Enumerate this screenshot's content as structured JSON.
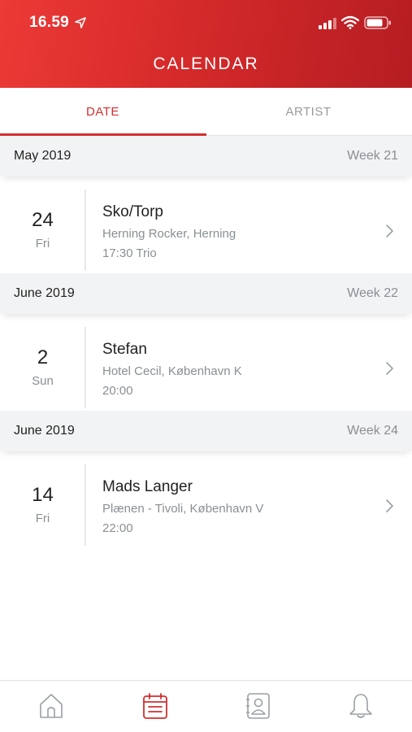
{
  "status_bar": {
    "time": "16.59"
  },
  "header": {
    "title": "CALENDAR"
  },
  "tabs": [
    {
      "label": "DATE",
      "active": true
    },
    {
      "label": "ARTIST",
      "active": false
    }
  ],
  "sections": [
    {
      "month": "May 2019",
      "week": "Week 21",
      "event": {
        "day": "24",
        "weekday": "Fri",
        "name": "Sko/Torp",
        "venue": "Herning Rocker, Herning",
        "time": "17:30  Trio"
      }
    },
    {
      "month": "June 2019",
      "week": "Week 22",
      "event": {
        "day": "2",
        "weekday": "Sun",
        "name": "Stefan",
        "venue": "Hotel Cecil, København K",
        "time": "20:00"
      }
    },
    {
      "month": "June 2019",
      "week": "Week 24",
      "event": {
        "day": "14",
        "weekday": "Fri",
        "name": "Mads Langer",
        "venue": "Plænen - Tivoli, København V",
        "time": "22:00"
      }
    }
  ],
  "tab_bar": {
    "items": [
      {
        "icon": "home-icon",
        "active": false
      },
      {
        "icon": "calendar-icon",
        "active": true
      },
      {
        "icon": "contacts-icon",
        "active": false
      },
      {
        "icon": "bell-icon",
        "active": false
      }
    ]
  },
  "colors": {
    "accent": "#d32f2f",
    "header_start": "#ec3a36",
    "header_end": "#b51d22",
    "muted_text": "#8a8f94",
    "icon_gray": "#9aa0a6"
  }
}
